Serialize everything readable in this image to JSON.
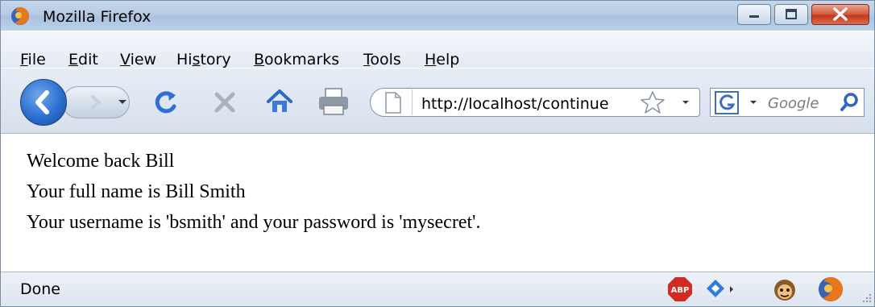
{
  "window": {
    "title": "Mozilla Firefox"
  },
  "menu": [
    "File",
    "Edit",
    "View",
    "History",
    "Bookmarks",
    "Tools",
    "Help"
  ],
  "menu_underline": [
    "F",
    "E",
    "V",
    "s",
    "B",
    "T",
    "H"
  ],
  "navigation": {
    "url": "http://localhost/continue",
    "search_placeholder": "Google"
  },
  "content": {
    "lines": [
      "Welcome back Bill",
      "Your full name is Bill Smith",
      "Your username is 'bsmith' and your password is 'mysecret'."
    ]
  },
  "statusbar": {
    "text": "Done",
    "abp_label": "ABP"
  },
  "icons": [
    "firefox-icon",
    "minimize-icon",
    "maximize-icon",
    "close-icon",
    "back-arrow-icon",
    "forward-arrow-icon",
    "history-dropdown-icon",
    "reload-icon",
    "stop-icon",
    "home-icon",
    "print-icon",
    "page-icon",
    "bookmark-star-icon",
    "url-dropdown-icon",
    "google-icon",
    "search-engine-dropdown-icon",
    "search-magnifier-icon",
    "adblock-icon",
    "addon-icon",
    "greasemonkey-icon",
    "resize-grip-icon"
  ]
}
